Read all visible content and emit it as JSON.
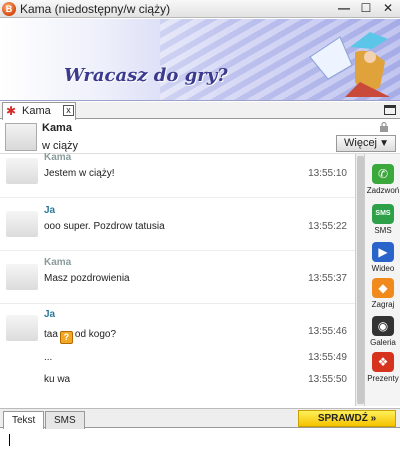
{
  "window": {
    "title": "Kama (niedostępny/w ciąży)",
    "app_icon": "B",
    "minimize": "—",
    "maximize": "☐",
    "close": "✕"
  },
  "banner": {
    "text": "Wracasz do gry?"
  },
  "tab": {
    "label": "Kama",
    "close": "x",
    "icon": "✱"
  },
  "contact": {
    "name": "Kama",
    "status": "w ciąży",
    "more_label": "Więcej",
    "more_arrow": "▼"
  },
  "messages": [
    {
      "sender": "Kama",
      "sender_type": "kama",
      "lines": [
        {
          "text": "Jestem w ciąży!",
          "time": "13:55:10"
        }
      ]
    },
    {
      "sender": "Ja",
      "sender_type": "ja",
      "lines": [
        {
          "text": "ooo super. Pozdrow tatusia",
          "time": "13:55:22"
        }
      ]
    },
    {
      "sender": "Kama",
      "sender_type": "kama",
      "lines": [
        {
          "text": "Masz pozdrowienia",
          "time": "13:55:37"
        }
      ]
    },
    {
      "sender": "Ja",
      "sender_type": "ja",
      "lines": [
        {
          "text_before": "taa",
          "emoticon": "?",
          "text_after": "od kogo?",
          "time": "13:55:46"
        },
        {
          "text": "...",
          "time": "13:55:49"
        },
        {
          "text": "ku wa",
          "time": "13:55:50"
        }
      ]
    }
  ],
  "side_actions": [
    {
      "label": "Zadzwoń",
      "icon": "phone-icon",
      "glyph": "✆",
      "color": "#3aa83a"
    },
    {
      "label": "SMS",
      "icon": "sms-icon",
      "glyph": "SMS",
      "color": "#2fa04a"
    },
    {
      "label": "Wideo",
      "icon": "video-camera-icon",
      "glyph": "▶",
      "color": "#2a63c9"
    },
    {
      "label": "Zagraj",
      "icon": "game-icon",
      "glyph": "◆",
      "color": "#f08a1c"
    },
    {
      "label": "Galeria",
      "icon": "camera-icon",
      "glyph": "◉",
      "color": "#333333"
    },
    {
      "label": "Prezenty",
      "icon": "gift-icon",
      "glyph": "❖",
      "color": "#d6331f"
    }
  ],
  "input_tabs": {
    "text": "Tekst",
    "sms": "SMS"
  },
  "check_button": "SPRAWDŹ »",
  "input": {
    "value": ""
  }
}
